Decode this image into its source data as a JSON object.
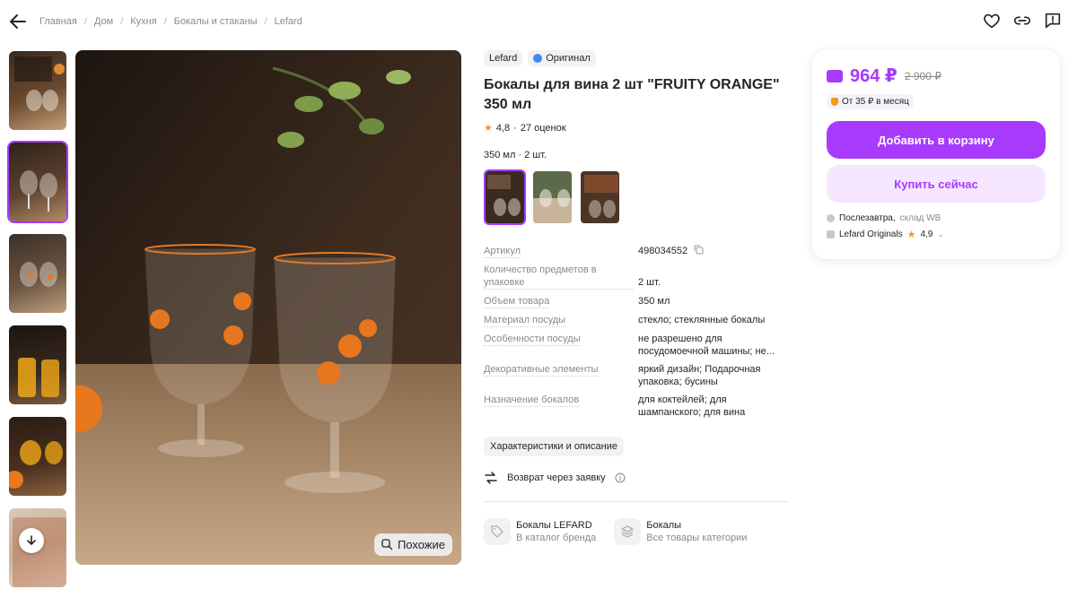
{
  "breadcrumbs": [
    "Главная",
    "Дом",
    "Кухня",
    "Бокалы и стаканы",
    "Lefard"
  ],
  "breadcrumb_sep": "/",
  "gallery": {
    "similar_label": "Похожие",
    "thumb_count": 6,
    "selected_index": 1
  },
  "product": {
    "brand_badge": "Lefard",
    "original_badge": "Оригинал",
    "title": "Бокалы для вина 2 шт \"FRUITY ORANGE\" 350 мл",
    "rating": "4,8",
    "reviews": "27 оценок",
    "rating_sep": "·",
    "variant_label": "350 мл · 2 шт.",
    "variants_selected": 0
  },
  "specs": [
    {
      "k": "Артикул",
      "v": "498034552"
    },
    {
      "k": "Количество предметов в упаковке",
      "v": "2 шт."
    },
    {
      "k": "Объем товара",
      "v": "350 мл"
    },
    {
      "k": "Материал посуды",
      "v": "стекло; стеклянные бокалы"
    },
    {
      "k": "Особенности посуды",
      "v": "не разрешено для посудомоечной машины; не..."
    },
    {
      "k": "Декоративные элементы",
      "v": "яркий дизайн; Подарочная упаковка; бусины"
    },
    {
      "k": "Назначение бокалов",
      "v": "для коктейлей; для шампанского; для вина"
    }
  ],
  "chars_button": "Характеристики и описание",
  "return_label": "Возврат через заявку",
  "brand_links": [
    {
      "title": "Бокалы LEFARD",
      "sub": "В каталог бренда"
    },
    {
      "title": "Бокалы",
      "sub": "Все товары категории"
    }
  ],
  "buy": {
    "price": "964 ₽",
    "old_price": "2 900 ₽",
    "installment": "От 35 ₽ в месяц",
    "cart_button": "Добавить в корзину",
    "now_button": "Купить сейчас",
    "delivery": "Послезавтра,",
    "delivery_place": "склад WB",
    "seller": "Lefard Originals",
    "seller_rating": "4,9"
  },
  "colors": {
    "accent": "#a73afd",
    "accent_light": "#f6e6ff",
    "star": "#f09c1b"
  }
}
